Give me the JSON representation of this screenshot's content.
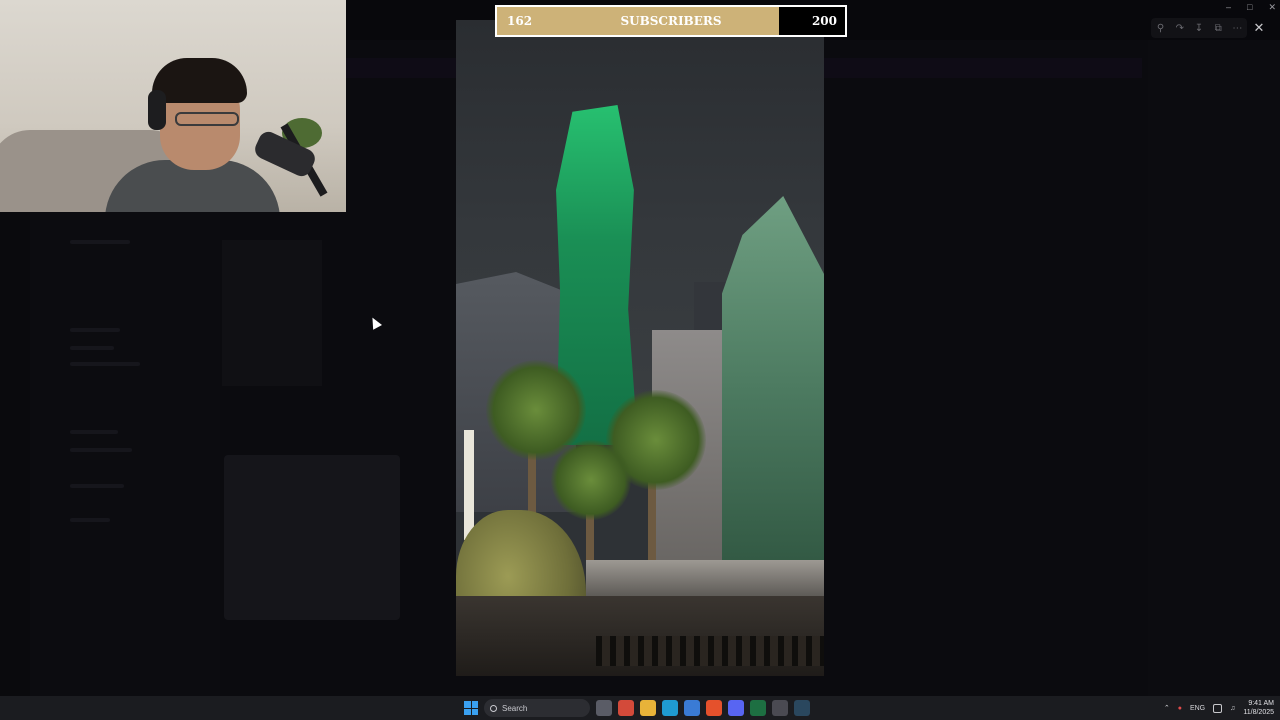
{
  "subscriber_goal": {
    "current": "162",
    "label": "SUBSCRIBERS",
    "goal": "200",
    "progress": 0.81,
    "fill_color": "#cdb278"
  },
  "viewer": {
    "controls": [
      "zoom-in-icon",
      "rotate-icon",
      "download-icon",
      "open-external-icon",
      "more-icon"
    ],
    "close_icon": "close-icon"
  },
  "window_controls": [
    "minimize-icon",
    "maximize-icon",
    "close-icon"
  ],
  "taskbar": {
    "search_label": "Search",
    "apps": [
      {
        "name": "task-view-icon",
        "color": "#5a5c66"
      },
      {
        "name": "chrome-icon",
        "color": "#d34a3a"
      },
      {
        "name": "file-explorer-icon",
        "color": "#e8b339"
      },
      {
        "name": "edge-icon",
        "color": "#1f9bd1"
      },
      {
        "name": "store-icon",
        "color": "#3a7bd5"
      },
      {
        "name": "brave-icon",
        "color": "#e5512c"
      },
      {
        "name": "discord-icon",
        "color": "#5865f2"
      },
      {
        "name": "excel-icon",
        "color": "#1d6f42"
      },
      {
        "name": "obs-icon",
        "color": "#4a4a52"
      },
      {
        "name": "steam-icon",
        "color": "#2a475e"
      }
    ],
    "tray": {
      "language": "ENG",
      "time": "9:41 AM",
      "date": "11/8/2025"
    }
  }
}
